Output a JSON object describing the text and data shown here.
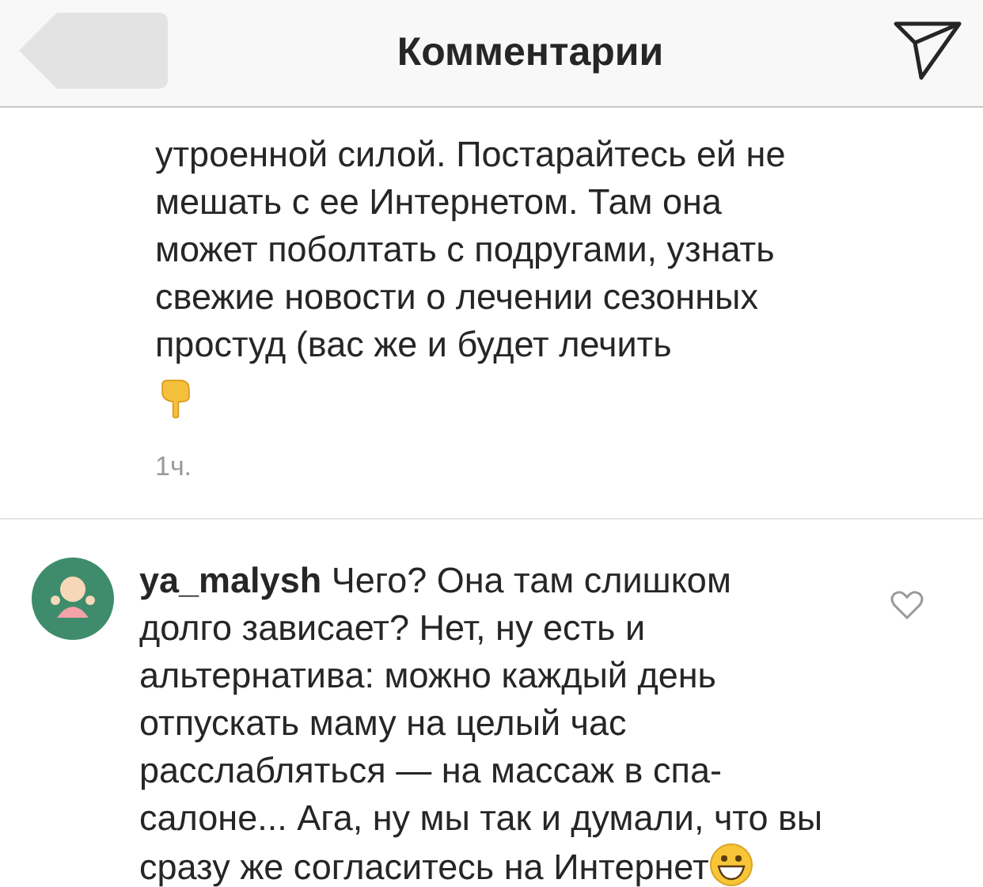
{
  "header": {
    "title": "Комментарии"
  },
  "comments": [
    {
      "text": "утроенной силой. Постарайтесь ей не мешать с ее Интернетом. Там она может поболтать с подругами, узнать свежие новости о лечении сезонных простуд (вас же и будет лечить",
      "time": "1ч."
    },
    {
      "username": "ya_malysh",
      "text": "Чего? Она там слишком долго зависает? Нет, ну есть и альтернатива: можно каждый день отпускать маму на целый час расслабляться — на массаж в спа-салоне... Ага, ну мы так и думали, что вы сразу же согласитесь на Интернет",
      "liked": false
    }
  ]
}
